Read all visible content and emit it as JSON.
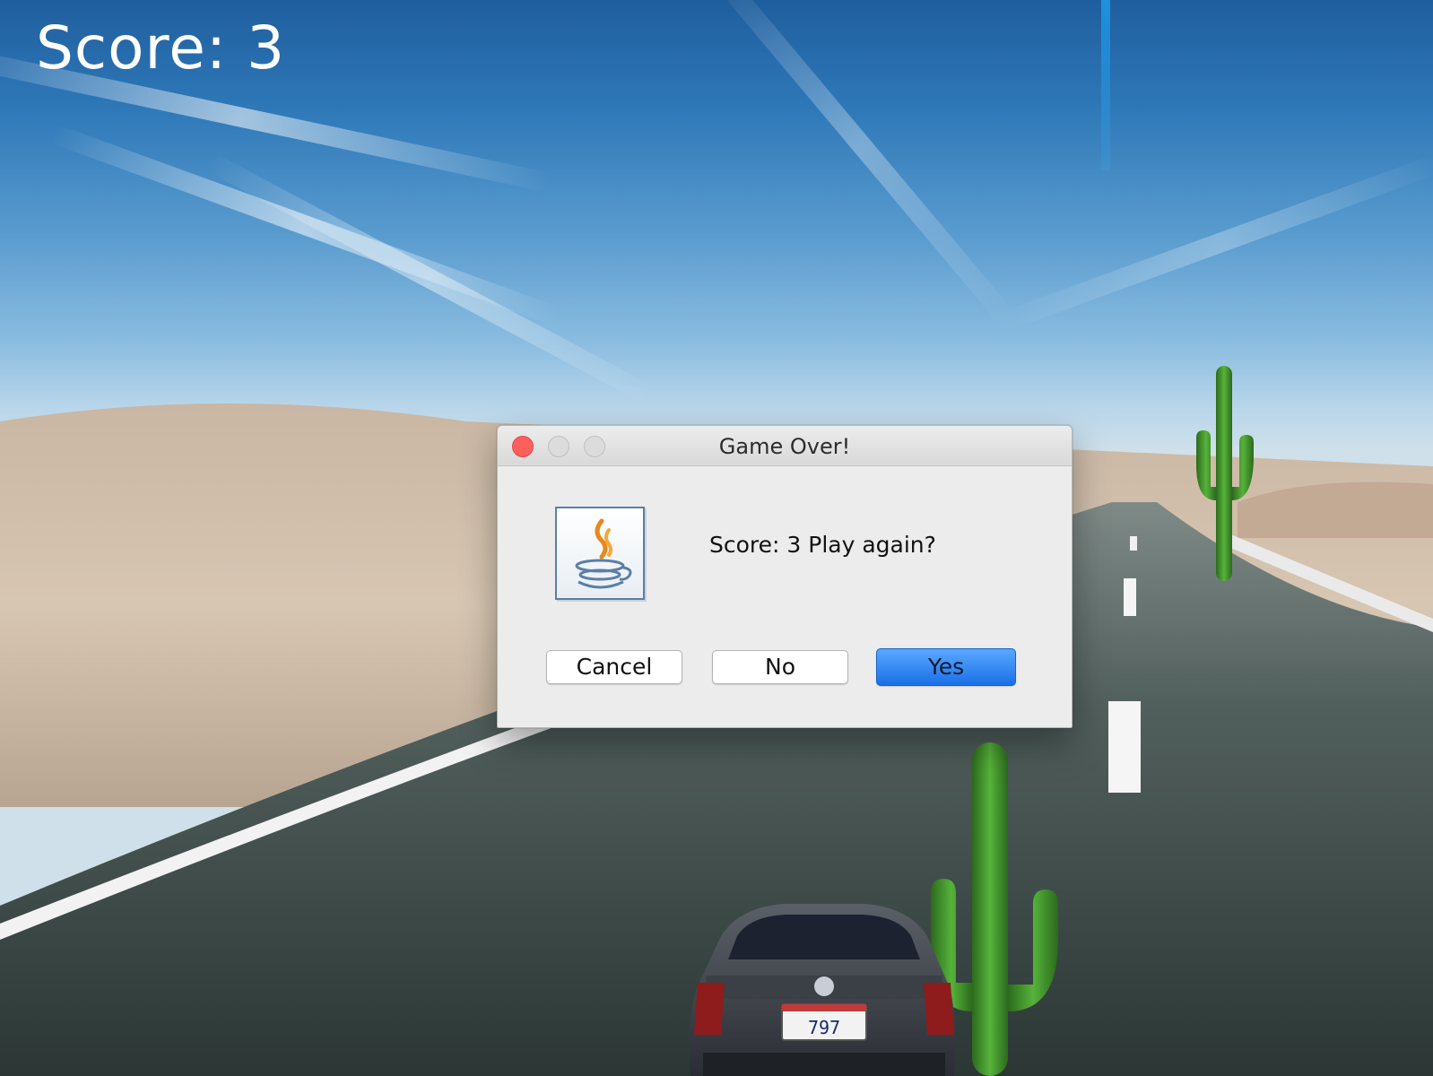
{
  "hud": {
    "score_text": "Score: 3"
  },
  "dialog": {
    "title": "Game Over!",
    "message": "Score: 3 Play again?",
    "icon": "java-coffee-cup-icon",
    "buttons": {
      "cancel": "Cancel",
      "no": "No",
      "yes": "Yes"
    },
    "default_button": "yes"
  },
  "car": {
    "plate": "797"
  },
  "colors": {
    "close": "#fc605c",
    "primary_button": "#1a6fe8",
    "cactus": "#3f9a2a"
  }
}
